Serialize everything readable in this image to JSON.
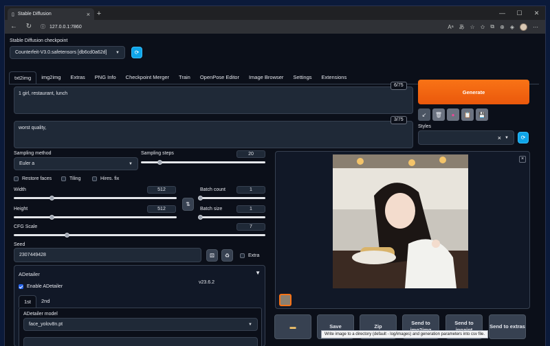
{
  "browser": {
    "tab_title": "Stable Diffusion",
    "url": "127.0.0.1:7860",
    "new_tab_symbol": "+",
    "controls": {
      "minimize": "—",
      "maximize": "☐",
      "close": "✕"
    }
  },
  "checkpoint": {
    "label": "Stable Diffusion checkpoint",
    "value": "Counterfeit-V3.0.safetensors [db6cd0a62d]"
  },
  "tabs": [
    "txt2img",
    "img2img",
    "Extras",
    "PNG Info",
    "Checkpoint Merger",
    "Train",
    "OpenPose Editor",
    "Image Browser",
    "Settings",
    "Extensions"
  ],
  "prompt": {
    "text": "1 girl, restaurant, lunch",
    "token_count": "6/75"
  },
  "negative_prompt": {
    "text": "worst quality,",
    "token_count": "3/75"
  },
  "generate_label": "Generate",
  "styles": {
    "label": "Styles",
    "clear": "×"
  },
  "sampling": {
    "method_label": "Sampling method",
    "method_value": "Euler a",
    "steps_label": "Sampling steps",
    "steps_value": "20",
    "steps_fraction": 0.15
  },
  "options": {
    "restore_faces": "Restore faces",
    "tiling": "Tiling",
    "hires_fix": "Hires. fix"
  },
  "width": {
    "label": "Width",
    "value": "512",
    "fraction": 0.23
  },
  "height": {
    "label": "Height",
    "value": "512",
    "fraction": 0.23
  },
  "batch_count": {
    "label": "Batch count",
    "value": "1",
    "fraction": 0.0
  },
  "batch_size": {
    "label": "Batch size",
    "value": "1",
    "fraction": 0.0
  },
  "cfg": {
    "label": "CFG Scale",
    "value": "7",
    "fraction": 0.21
  },
  "seed": {
    "label": "Seed",
    "value": "2307449428",
    "extra_label": "Extra"
  },
  "adetailer": {
    "title": "ADetailer",
    "enable_label": "Enable ADetailer",
    "version": "v23.6.2",
    "tabs": [
      "1st",
      "2nd"
    ],
    "model_label": "ADetailer model",
    "model_value": "face_yolov8n.pt"
  },
  "output_buttons": [
    "Save",
    "Zip",
    "Send to img2img",
    "Send to inpaint",
    "Send to extras"
  ],
  "tooltip": "Write image to a directory (default - log/images) and generation parameters into csv file.",
  "colors": {
    "accent": "#ea580c",
    "refresh": "#0ea5e9",
    "bg": "#0b0f19",
    "panel": "#1f2937"
  }
}
